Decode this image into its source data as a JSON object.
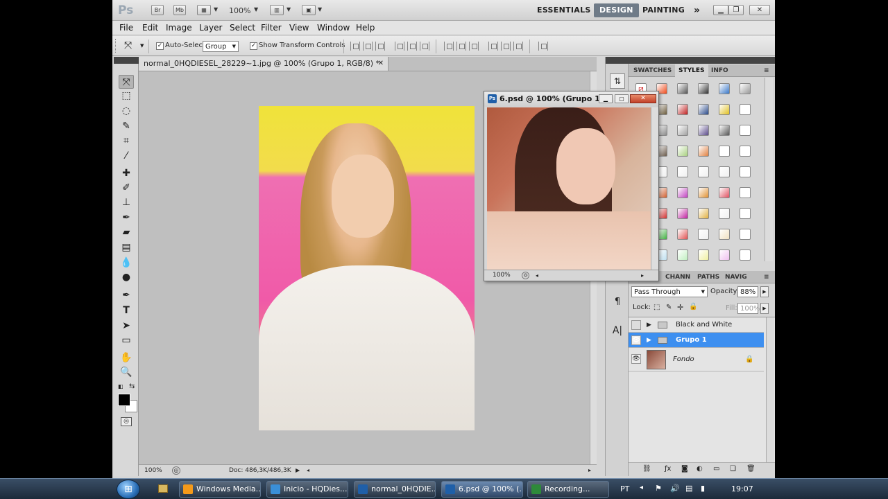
{
  "appbar": {
    "logo": "Ps",
    "bridge": "Br",
    "minibridge": "Mb",
    "zoom": "100%",
    "workspaces": [
      "ESSENTIALS",
      "DESIGN",
      "PAINTING"
    ],
    "active_workspace": "DESIGN",
    "more": "»"
  },
  "menu": [
    "File",
    "Edit",
    "Image",
    "Layer",
    "Select",
    "Filter",
    "View",
    "Window",
    "Help"
  ],
  "options": {
    "auto_select_label": "Auto-Select:",
    "auto_select_value": "Group",
    "transform_label": "Show Transform Controls"
  },
  "document": {
    "tab_title": "normal_0HQDIESEL_28229~1.jpg @ 100% (Grupo 1, RGB/8) *",
    "zoom": "100%",
    "doc_info": "Doc: 486,3K/486,3K"
  },
  "float_window": {
    "title": "6.psd @ 100% (Grupo 1...",
    "zoom": "100%"
  },
  "panels": {
    "top_tabs": [
      "SWATCHES",
      "STYLES",
      "INFO"
    ],
    "active_top_tab": "STYLES",
    "bottom_tabs": [
      "CHANN",
      "PATHS",
      "NAVIG"
    ],
    "blend_mode": "Pass Through",
    "opacity_label": "Opacity:",
    "opacity_value": "88%",
    "lock_label": "Lock:",
    "fill_label": "Fill:",
    "fill_value": "100%",
    "layers": [
      {
        "name": "Black and White",
        "visible": false,
        "type": "group",
        "selected": false
      },
      {
        "name": "Grupo 1",
        "visible": true,
        "type": "group",
        "selected": true
      },
      {
        "name": "Fondo",
        "visible": true,
        "type": "image",
        "selected": false,
        "locked": true
      }
    ]
  },
  "taskbar": {
    "tasks": [
      {
        "label": "Windows Media...",
        "color": "#f59a1a",
        "active": false
      },
      {
        "label": "Inicio - HQDies...",
        "color": "#3a8fd8",
        "active": false
      },
      {
        "label": "normal_0HQDIE...",
        "color": "#1f5fa8",
        "active": false
      },
      {
        "label": "6.psd @ 100% (...",
        "color": "#1f5fa8",
        "active": true
      },
      {
        "label": "Recording...",
        "color": "#2e8a3a",
        "active": false
      }
    ],
    "lang": "PT",
    "clock": "19:07"
  }
}
